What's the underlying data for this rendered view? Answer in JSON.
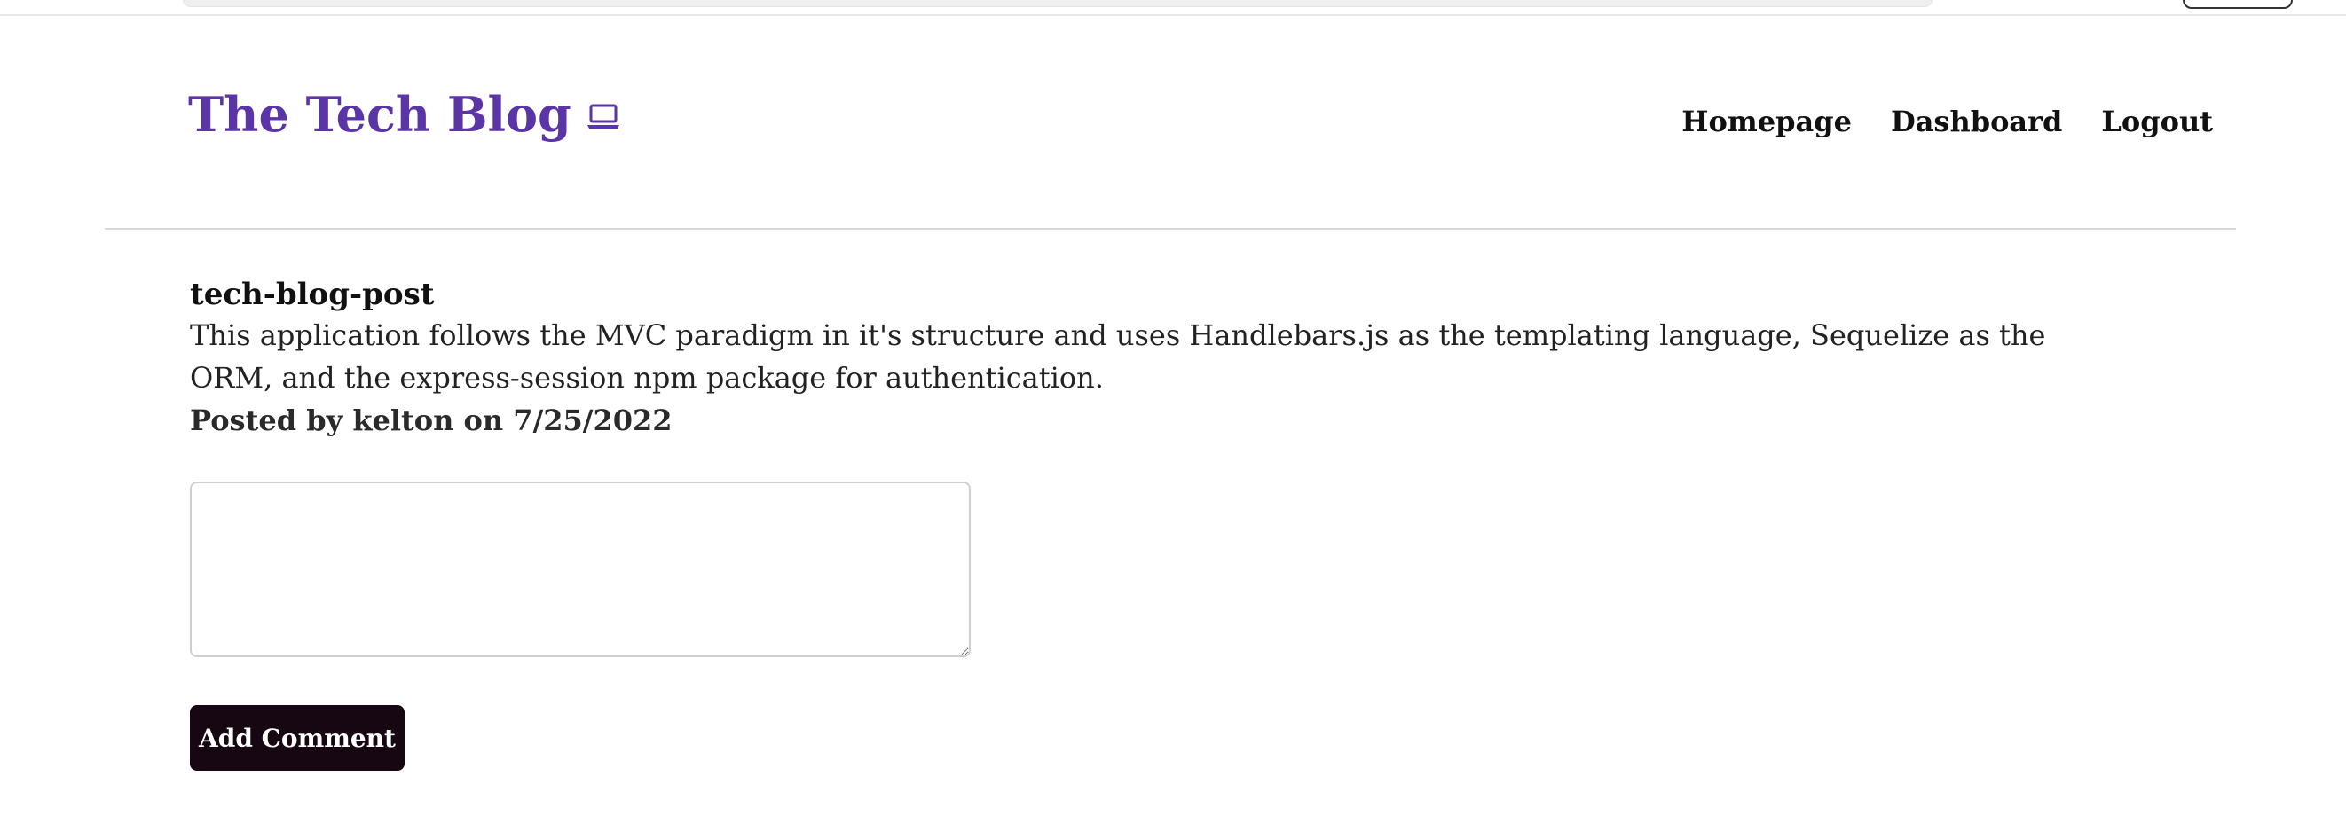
{
  "header": {
    "brand": "The Tech Blog",
    "brand_icon": "laptop-icon",
    "nav": {
      "homepage": "Homepage",
      "dashboard": "Dashboard",
      "logout": "Logout"
    }
  },
  "post": {
    "title": "tech-blog-post",
    "body": "This application follows the MVC paradigm in it's structure and uses Handlebars.js as the templating language, Sequelize as the ORM, and the express-session npm package for authentication.",
    "meta": "Posted by kelton on 7/25/2022"
  },
  "comment_form": {
    "value": "",
    "placeholder": "",
    "submit_label": "Add Comment"
  },
  "colors": {
    "brand": "#5b35a7",
    "button_bg": "#170713",
    "divider": "#d6d6d6"
  }
}
